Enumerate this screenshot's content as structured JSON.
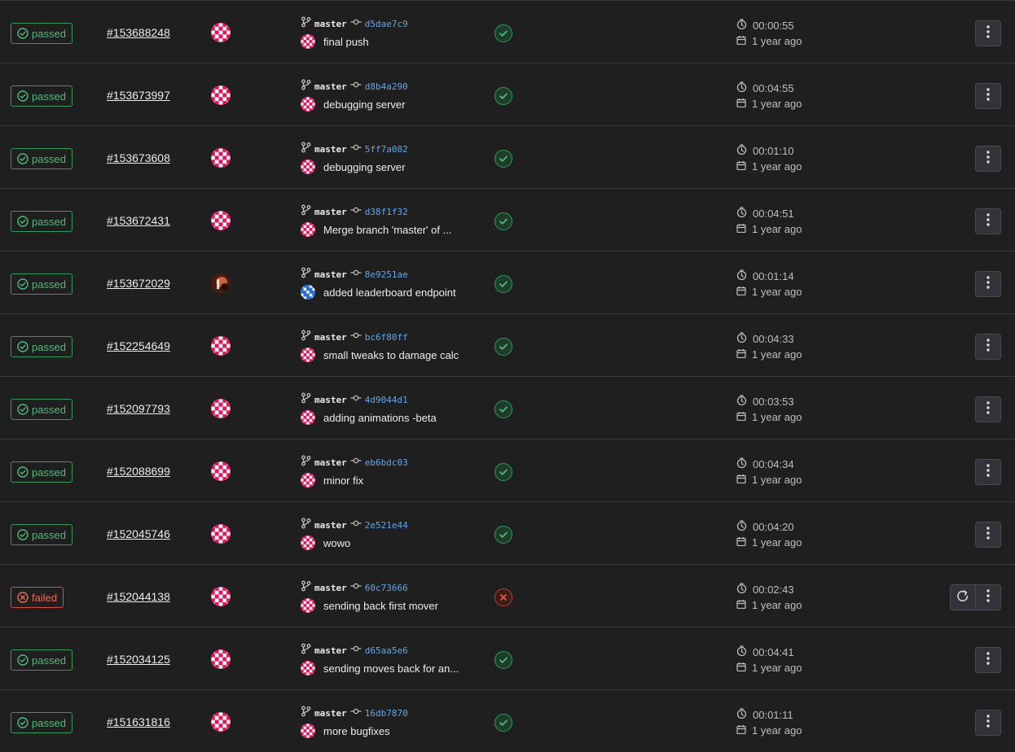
{
  "colors": {
    "background": "#1f1f1f",
    "passed": "#52b87a",
    "failed": "#ec6a5b",
    "sha_link": "#63a6e9"
  },
  "icons": {
    "status_passed": "check-circle-icon",
    "status_failed": "x-circle-icon",
    "branch": "branch-icon",
    "commit": "commit-icon",
    "duration": "clock-icon",
    "finished": "calendar-icon",
    "actions": "kebab-menu-icon",
    "retry": "retry-icon"
  },
  "pipelines": [
    {
      "status": "passed",
      "status_label": "passed",
      "id": "#153688248",
      "branch": "master",
      "sha": "d5dae7c9",
      "title": "final push",
      "author_avatar": "pink",
      "duration": "00:00:55",
      "finished": "1 year ago",
      "retry": false
    },
    {
      "status": "passed",
      "status_label": "passed",
      "id": "#153673997",
      "branch": "master",
      "sha": "d8b4a290",
      "title": "debugging server",
      "author_avatar": "pink",
      "duration": "00:04:55",
      "finished": "1 year ago",
      "retry": false
    },
    {
      "status": "passed",
      "status_label": "passed",
      "id": "#153673608",
      "branch": "master",
      "sha": "5ff7a082",
      "title": "debugging server",
      "author_avatar": "pink",
      "duration": "00:01:10",
      "finished": "1 year ago",
      "retry": false
    },
    {
      "status": "passed",
      "status_label": "passed",
      "id": "#153672431",
      "branch": "master",
      "sha": "d38f1f32",
      "title": "Merge branch 'master' of ...",
      "author_avatar": "pink",
      "duration": "00:04:51",
      "finished": "1 year ago",
      "retry": false
    },
    {
      "status": "passed",
      "status_label": "passed",
      "id": "#153672029",
      "branch": "master",
      "sha": "8e9251ae",
      "title": "added leaderboard endpoint",
      "author_avatar": "photo",
      "commit_avatar": "blue",
      "duration": "00:01:14",
      "finished": "1 year ago",
      "retry": false
    },
    {
      "status": "passed",
      "status_label": "passed",
      "id": "#152254649",
      "branch": "master",
      "sha": "bc6f80ff",
      "title": "small tweaks to damage calc",
      "author_avatar": "pink",
      "duration": "00:04:33",
      "finished": "1 year ago",
      "retry": false
    },
    {
      "status": "passed",
      "status_label": "passed",
      "id": "#152097793",
      "branch": "master",
      "sha": "4d9044d1",
      "title": "adding animations -beta",
      "author_avatar": "pink",
      "duration": "00:03:53",
      "finished": "1 year ago",
      "retry": false
    },
    {
      "status": "passed",
      "status_label": "passed",
      "id": "#152088699",
      "branch": "master",
      "sha": "eb6bdc03",
      "title": "minor fix",
      "author_avatar": "pink",
      "duration": "00:04:34",
      "finished": "1 year ago",
      "retry": false
    },
    {
      "status": "passed",
      "status_label": "passed",
      "id": "#152045746",
      "branch": "master",
      "sha": "2e521e44",
      "title": "wowo",
      "author_avatar": "pink",
      "duration": "00:04:20",
      "finished": "1 year ago",
      "retry": false
    },
    {
      "status": "failed",
      "status_label": "failed",
      "id": "#152044138",
      "branch": "master",
      "sha": "60c73666",
      "title": "sending back first mover",
      "author_avatar": "pink",
      "duration": "00:02:43",
      "finished": "1 year ago",
      "retry": true
    },
    {
      "status": "passed",
      "status_label": "passed",
      "id": "#152034125",
      "branch": "master",
      "sha": "d65aa5e6",
      "title": "sending moves back for an...",
      "author_avatar": "pink",
      "duration": "00:04:41",
      "finished": "1 year ago",
      "retry": false
    },
    {
      "status": "passed",
      "status_label": "passed",
      "id": "#151631816",
      "branch": "master",
      "sha": "16db7870",
      "title": "more bugfixes",
      "author_avatar": "pink",
      "duration": "00:01:11",
      "finished": "1 year ago",
      "retry": false
    }
  ]
}
